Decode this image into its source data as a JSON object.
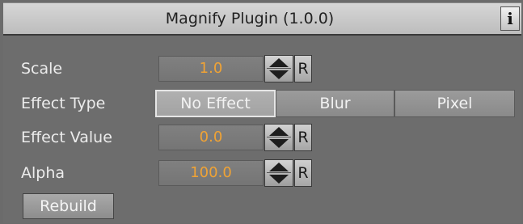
{
  "header": {
    "title": "Magnify Plugin (1.0.0)",
    "info_label": "i"
  },
  "rows": {
    "scale": {
      "label": "Scale",
      "value": "1.0",
      "reset_label": "R"
    },
    "effect_type": {
      "label": "Effect Type",
      "options": [
        "No Effect",
        "Blur",
        "Pixel"
      ],
      "selected": "No Effect"
    },
    "effect_value": {
      "label": "Effect Value",
      "value": "0.0",
      "reset_label": "R"
    },
    "alpha": {
      "label": "Alpha",
      "value": "100.0",
      "reset_label": "R"
    }
  },
  "actions": {
    "rebuild_label": "Rebuild"
  },
  "colors": {
    "panel_bg": "#6d6d6d",
    "header_bg": "#c9c9c9",
    "value_text": "#f0a335",
    "label_text": "#ececec"
  },
  "icons": {
    "spinner": "up-down-arrows-icon",
    "info": "info-icon"
  }
}
